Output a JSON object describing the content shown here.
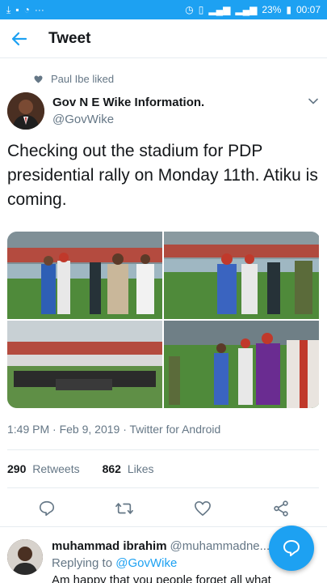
{
  "status_bar": {
    "battery": "23%",
    "time": "00:07"
  },
  "app_bar": {
    "title": "Tweet"
  },
  "social_context": {
    "text": "Paul Ibe liked"
  },
  "author": {
    "name": "Gov N E Wike Information.",
    "handle": "@GovWike"
  },
  "tweet": {
    "text": "Checking out the stadium for PDP presidential rally on Monday 11th. Atiku is coming.",
    "meta": "1:49 PM · Feb 9, 2019 · Twitter for Android"
  },
  "stats": {
    "retweets_count": "290",
    "retweets_label": "Retweets",
    "likes_count": "862",
    "likes_label": "Likes"
  },
  "reply": {
    "name": "muhammad ibrahim",
    "handle": "@muhammadne...",
    "replying_prefix": "Replying to",
    "replying_to": "@GovWike",
    "text": "Am happy that you people forget all what"
  },
  "icons": {
    "back": "arrow-left-icon",
    "caret": "chevron-down-icon",
    "reply": "comment-icon",
    "retweet": "retweet-icon",
    "like": "heart-icon",
    "share": "share-icon",
    "compose": "compose-reply-icon"
  },
  "colors": {
    "accent": "#1da1f2",
    "secondary_text": "#657786"
  }
}
